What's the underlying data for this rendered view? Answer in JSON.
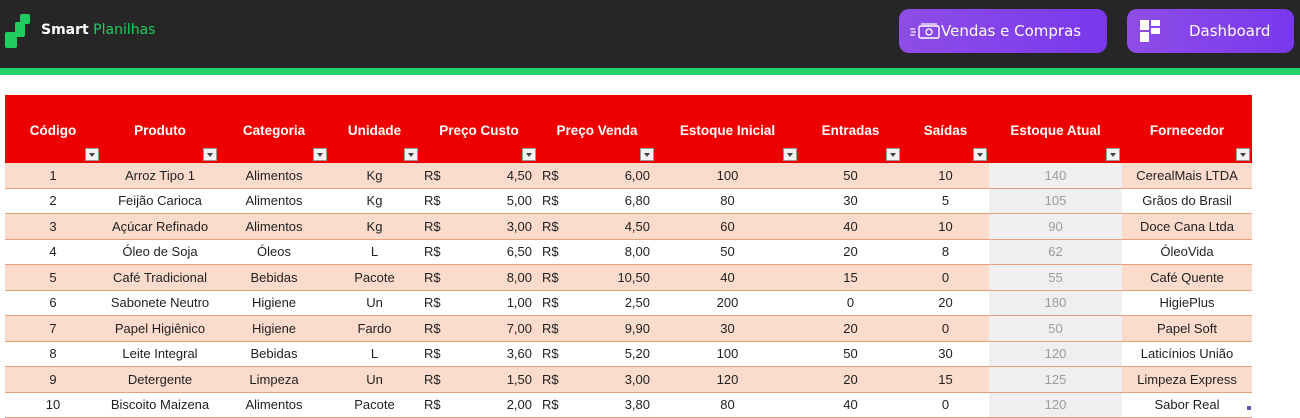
{
  "app": {
    "brand_bold": "Smart",
    "brand_rest": " Planilhas",
    "brand_color": "#1fcc5d"
  },
  "nav": {
    "vendas_label": "Vendas e Compras",
    "vendas_icon": "money-icon",
    "dashboard_label": "Dashboard",
    "dashboard_icon": "dashboard-icon",
    "button_color": "#8a45e8"
  },
  "table": {
    "header_color": "#ef0000",
    "row_alt_color": "#fbdccc",
    "currency": "R$",
    "columns": [
      "Código",
      "Produto",
      "Categoria",
      "Unidade",
      "Preço Custo",
      "Preço Venda",
      "Estoque Inicial",
      "Entradas",
      "Saídas",
      "Estoque Atual",
      "Fornecedor"
    ],
    "rows": [
      {
        "codigo": "1",
        "produto": "Arroz Tipo 1",
        "categoria": "Alimentos",
        "unidade": "Kg",
        "custo": "4,50",
        "venda": "6,00",
        "estoque_inicial": "100",
        "entradas": "50",
        "saidas": "10",
        "estoque_atual": "140",
        "fornecedor": "CerealMais LTDA"
      },
      {
        "codigo": "2",
        "produto": "Feijão Carioca",
        "categoria": "Alimentos",
        "unidade": "Kg",
        "custo": "5,00",
        "venda": "6,80",
        "estoque_inicial": "80",
        "entradas": "30",
        "saidas": "5",
        "estoque_atual": "105",
        "fornecedor": "Grãos do Brasil"
      },
      {
        "codigo": "3",
        "produto": "Açúcar Refinado",
        "categoria": "Alimentos",
        "unidade": "Kg",
        "custo": "3,00",
        "venda": "4,50",
        "estoque_inicial": "60",
        "entradas": "40",
        "saidas": "10",
        "estoque_atual": "90",
        "fornecedor": "Doce Cana Ltda"
      },
      {
        "codigo": "4",
        "produto": "Óleo de Soja",
        "categoria": "Óleos",
        "unidade": "L",
        "custo": "6,50",
        "venda": "8,00",
        "estoque_inicial": "50",
        "entradas": "20",
        "saidas": "8",
        "estoque_atual": "62",
        "fornecedor": "ÓleoVida"
      },
      {
        "codigo": "5",
        "produto": "Café Tradicional",
        "categoria": "Bebidas",
        "unidade": "Pacote",
        "custo": "8,00",
        "venda": "10,50",
        "estoque_inicial": "40",
        "entradas": "15",
        "saidas": "0",
        "estoque_atual": "55",
        "fornecedor": "Café Quente"
      },
      {
        "codigo": "6",
        "produto": "Sabonete Neutro",
        "categoria": "Higiene",
        "unidade": "Un",
        "custo": "1,00",
        "venda": "2,50",
        "estoque_inicial": "200",
        "entradas": "0",
        "saidas": "20",
        "estoque_atual": "180",
        "fornecedor": "HigiePlus"
      },
      {
        "codigo": "7",
        "produto": "Papel Higiênico",
        "categoria": "Higiene",
        "unidade": "Fardo",
        "custo": "7,00",
        "venda": "9,90",
        "estoque_inicial": "30",
        "entradas": "20",
        "saidas": "0",
        "estoque_atual": "50",
        "fornecedor": "Papel Soft"
      },
      {
        "codigo": "8",
        "produto": "Leite Integral",
        "categoria": "Bebidas",
        "unidade": "L",
        "custo": "3,60",
        "venda": "5,20",
        "estoque_inicial": "100",
        "entradas": "50",
        "saidas": "30",
        "estoque_atual": "120",
        "fornecedor": "Laticínios União"
      },
      {
        "codigo": "9",
        "produto": "Detergente",
        "categoria": "Limpeza",
        "unidade": "Un",
        "custo": "1,50",
        "venda": "3,00",
        "estoque_inicial": "120",
        "entradas": "20",
        "saidas": "15",
        "estoque_atual": "125",
        "fornecedor": "Limpeza Express"
      },
      {
        "codigo": "10",
        "produto": "Biscoito Maizena",
        "categoria": "Alimentos",
        "unidade": "Pacote",
        "custo": "2,00",
        "venda": "3,80",
        "estoque_inicial": "80",
        "entradas": "40",
        "saidas": "0",
        "estoque_atual": "120",
        "fornecedor": "Sabor Real"
      }
    ]
  }
}
